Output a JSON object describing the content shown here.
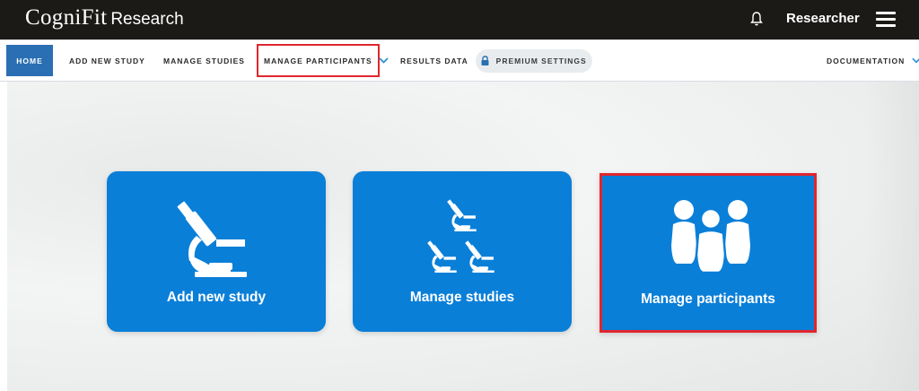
{
  "header": {
    "brand": "CogniFit",
    "brand_sub": "Research",
    "user": "Researcher",
    "icons": [
      "bell-icon",
      "hamburger-menu-icon"
    ]
  },
  "nav": {
    "home": "HOME",
    "add_study": "ADD NEW STUDY",
    "manage_studies": "MANAGE STUDIES",
    "manage_participants": "MANAGE PARTICIPANTS",
    "results_data": "RESULTS DATA",
    "premium_settings": "PREMIUM SETTINGS",
    "documentation": "DOCUMENTATION"
  },
  "cards": [
    {
      "label": "Add new study",
      "icon": "microscope-icon"
    },
    {
      "label": "Manage studies",
      "icon": "microscopes-icon"
    },
    {
      "label": "Manage participants",
      "icon": "people-group-icon"
    }
  ],
  "colors": {
    "topbar": "#1c1a17",
    "accent": "#0a7fd8",
    "home_tab": "#2a6fb3",
    "highlight": "#e0262e"
  }
}
